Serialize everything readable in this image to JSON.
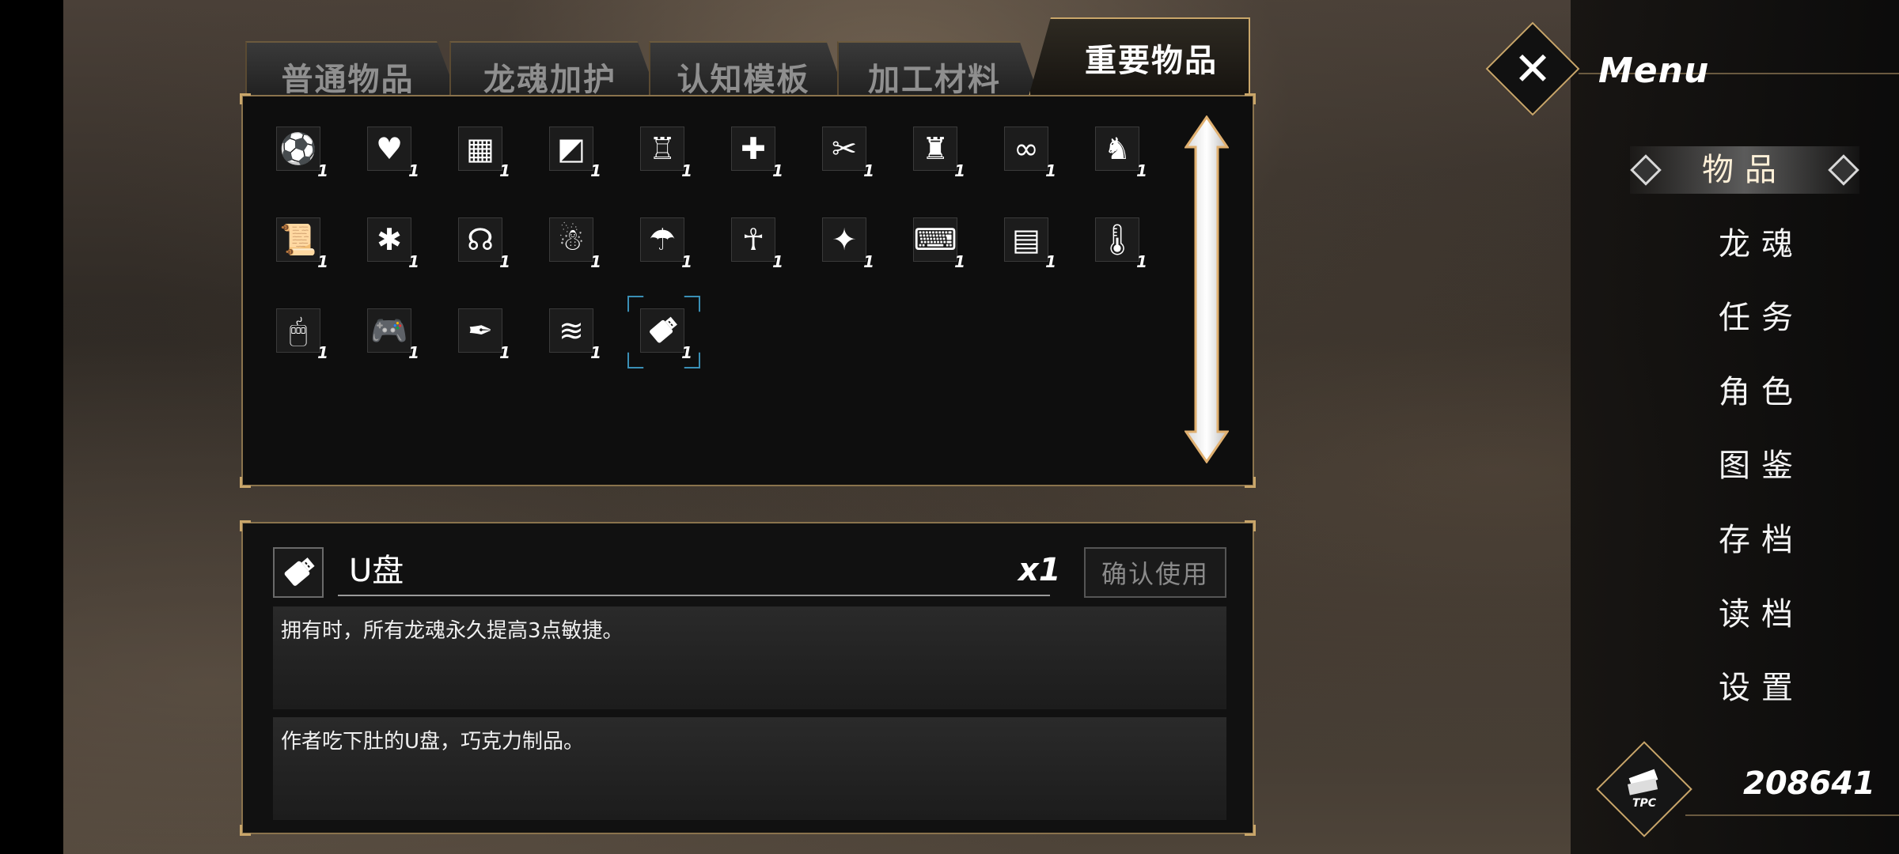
{
  "tabs": [
    {
      "label": "普通物品",
      "active": false
    },
    {
      "label": "龙魂加护",
      "active": false
    },
    {
      "label": "认知模板",
      "active": false
    },
    {
      "label": "加工材料",
      "active": false
    },
    {
      "label": "重要物品",
      "active": true
    }
  ],
  "items": [
    {
      "icon": "soccer-ball-icon",
      "glyph": "⚽",
      "qty": "1"
    },
    {
      "icon": "heart-emblem-icon",
      "glyph": "♥",
      "qty": "1"
    },
    {
      "icon": "microchip-icon",
      "glyph": "▦",
      "qty": "1"
    },
    {
      "icon": "tag-icon",
      "glyph": "◩",
      "qty": "1"
    },
    {
      "icon": "pipe-organ-icon",
      "glyph": "♖",
      "qty": "1"
    },
    {
      "icon": "bandage-icon",
      "glyph": "✚",
      "qty": "1"
    },
    {
      "icon": "chopsticks-icon",
      "glyph": "✂",
      "qty": "1"
    },
    {
      "icon": "totem-icon",
      "glyph": "♜",
      "qty": "1"
    },
    {
      "icon": "glasses-icon",
      "glyph": "∞",
      "qty": "1"
    },
    {
      "icon": "unicorn-icon",
      "glyph": "♞",
      "qty": "1"
    },
    {
      "icon": "scroll-icon",
      "glyph": "📜",
      "qty": "1"
    },
    {
      "icon": "scarab-icon",
      "glyph": "✱",
      "qty": "1"
    },
    {
      "icon": "stethoscope-icon",
      "glyph": "☊",
      "qty": "1"
    },
    {
      "icon": "snowman-icon",
      "glyph": "☃",
      "qty": "1"
    },
    {
      "icon": "jellyfish-icon",
      "glyph": "☂",
      "qty": "1"
    },
    {
      "icon": "egyptian-figure-icon",
      "glyph": "☥",
      "qty": "1"
    },
    {
      "icon": "magic-book-icon",
      "glyph": "✦",
      "qty": "1"
    },
    {
      "icon": "keyboard-icon",
      "glyph": "⌨",
      "qty": "1"
    },
    {
      "icon": "id-card-icon",
      "glyph": "▤",
      "qty": "1"
    },
    {
      "icon": "thermometer-icon",
      "glyph": "🌡",
      "qty": "1"
    },
    {
      "icon": "mouse-icon",
      "glyph": "🖱",
      "qty": "1"
    },
    {
      "icon": "gamepad-icon",
      "glyph": "🎮",
      "qty": "1"
    },
    {
      "icon": "feather-icon",
      "glyph": "✒",
      "qty": "1"
    },
    {
      "icon": "sushi-icon",
      "glyph": "≋",
      "qty": "1"
    },
    {
      "icon": "usb-drive-icon",
      "glyph": "usb",
      "qty": "1",
      "selected": true
    }
  ],
  "detail": {
    "name": "U盘",
    "quantity": "x1",
    "use_button": "确认使用",
    "effect": "拥有时，所有龙魂永久提高3点敏捷。",
    "flavor": "作者吃下肚的U盘，巧克力制品。"
  },
  "menu": {
    "title": "Menu",
    "items": [
      "物品",
      "龙魂",
      "任务",
      "角色",
      "图鉴",
      "存档",
      "读档",
      "设置"
    ],
    "active_index": 0
  },
  "currency": {
    "label": "TPC",
    "value": "208641"
  },
  "colors": {
    "gold_border": "#c9a66a",
    "selection_cyan": "#3a8fb5"
  }
}
